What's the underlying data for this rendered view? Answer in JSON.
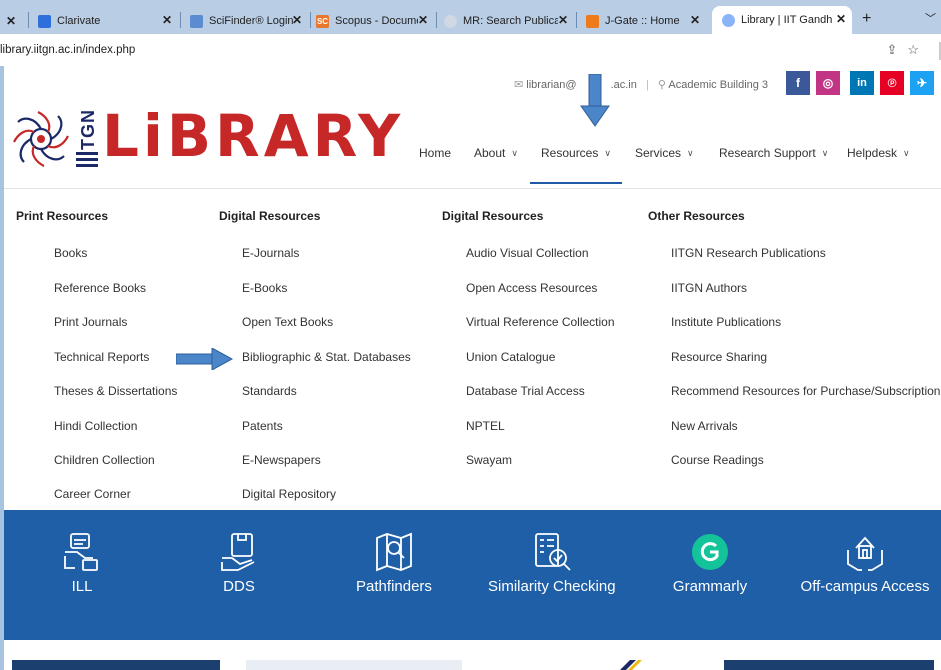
{
  "browser": {
    "tabs": [
      {
        "label": "Clarivate",
        "favicon_color": "#2f6fdb"
      },
      {
        "label": "SciFinder® Login",
        "favicon_color": "#5b8bd1"
      },
      {
        "label": "Scopus - Documen",
        "favicon_color": "#e8762d"
      },
      {
        "label": "MR: Search Publica",
        "favicon_color": "#aaaaaa"
      },
      {
        "label": "J-Gate :: Home",
        "favicon_color": "#ef7a1a"
      },
      {
        "label": "Library | IIT Gandh",
        "favicon_color": "#8ab4f8"
      }
    ],
    "scopus_favicon_text": "SC",
    "new_tab": "+",
    "url": "library.iitgn.ac.in/index.php"
  },
  "header": {
    "email": "librarian@",
    "email_tail": ".ac.in",
    "location": "Academic Building 3",
    "social": [
      {
        "icon": "facebook-icon",
        "glyph": "f",
        "color": "#3b5998"
      },
      {
        "icon": "instagram-icon",
        "glyph": "◎",
        "color": "#c13584"
      },
      {
        "icon": "linkedin-icon",
        "glyph": "in",
        "color": "#0077b5"
      },
      {
        "icon": "pinterest-icon",
        "glyph": "℗",
        "color": "#e60023"
      },
      {
        "icon": "twitter-icon",
        "glyph": "✈",
        "color": "#1da1f2"
      }
    ],
    "logo_vertical": "IITGN",
    "logo_text": "LiBRARY"
  },
  "nav": {
    "items": [
      "Home",
      "About",
      "Resources",
      "Services",
      "Research Support",
      "Helpdesk"
    ],
    "active": "Resources"
  },
  "dropdown": {
    "columns": [
      {
        "heading": "Print Resources",
        "items": [
          "Books",
          "Reference Books",
          "Print Journals",
          "Technical Reports",
          "Theses & Dissertations",
          "Hindi Collection",
          "Children Collection",
          "Career Corner"
        ]
      },
      {
        "heading": "Digital Resources",
        "items": [
          "E-Journals",
          "E-Books",
          "Open Text Books",
          "Bibliographic & Stat. Databases",
          "Standards",
          "Patents",
          "E-Newspapers",
          "Digital Repository"
        ]
      },
      {
        "heading": "Digital Resources",
        "items": [
          "Audio Visual Collection",
          "Open Access Resources",
          "Virtual Reference Collection",
          "Union Catalogue",
          "Database Trial Access",
          "NPTEL",
          "Swayam"
        ]
      },
      {
        "heading": "Other Resources",
        "items": [
          "IITGN Research Publications",
          "IITGN Authors",
          "Institute Publications",
          "Resource Sharing",
          "Recommend Resources for Purchase/Subscription",
          "New Arrivals",
          "Course Readings"
        ]
      }
    ]
  },
  "services": [
    {
      "label": "ILL",
      "icon": "ill-icon"
    },
    {
      "label": "DDS",
      "icon": "dds-icon"
    },
    {
      "label": "Pathfinders",
      "icon": "map-icon"
    },
    {
      "label": "Similarity Checking",
      "icon": "document-check-icon"
    },
    {
      "label": "Grammarly",
      "icon": "grammarly-icon"
    },
    {
      "label": "Off-campus Access",
      "icon": "home-hands-icon"
    }
  ],
  "colors": {
    "brand_red": "#c62828",
    "brand_blue": "#1e5fa8",
    "arrow_blue": "#4a86c8",
    "grammarly_green": "#15c39a"
  }
}
